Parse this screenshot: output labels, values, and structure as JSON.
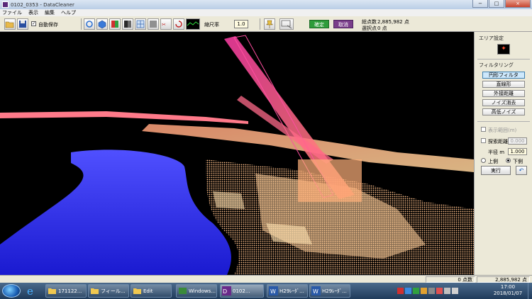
{
  "window": {
    "title": "0102_0353 - DataCleaner",
    "buttons": {
      "minimize": "−",
      "maximize": "□",
      "close": "×"
    }
  },
  "menu": [
    "ファイル",
    "表示",
    "編集",
    "ヘルプ"
  ],
  "toolbar": {
    "auto_save_label": "自動保存",
    "density_label": "縮尺率",
    "density_value": "1.0",
    "accept_label": "確定",
    "cancel_label": "取消",
    "point_count_label": "総点数",
    "point_count_value": "2,885,982 点",
    "selected_label": "選択点",
    "selected_value": "0 点"
  },
  "right_panel": {
    "area_setting_title": "エリア設定",
    "filtering_title": "フィルタリング",
    "filter_buttons": [
      "円形フィルタ",
      "直線形",
      "外接距離",
      "ノイズ消去",
      "高低ノイズ"
    ],
    "show_range_label": "表示範囲(m)",
    "search_distance_label": "探索距離",
    "search_distance_value": "0.000",
    "radius_label": "半径 m",
    "radius_value": "1.000",
    "radio_upper_label": "上側",
    "radio_lower_label": "下側",
    "run_button": "実行",
    "undo_icon": "undo-icon"
  },
  "statusbar": {
    "selected_points": "0 点数",
    "total_points": "2,885,982 点"
  },
  "taskbar": {
    "tasks": [
      "171122...",
      "フィール...",
      "Edit",
      "Windows...",
      "0102...",
      "H29ﾚｰﾀﾞ...",
      "H29ﾚｰﾀﾞ..."
    ],
    "clock_time": "17:00",
    "clock_date": "2018/01/07"
  },
  "colors": {
    "accent_green": "#2e9c3a",
    "accent_purple": "#7a3e8a",
    "point_high": "#ff4ea0",
    "point_mid": "#ffb87a",
    "point_low": "#2a2ae0"
  }
}
